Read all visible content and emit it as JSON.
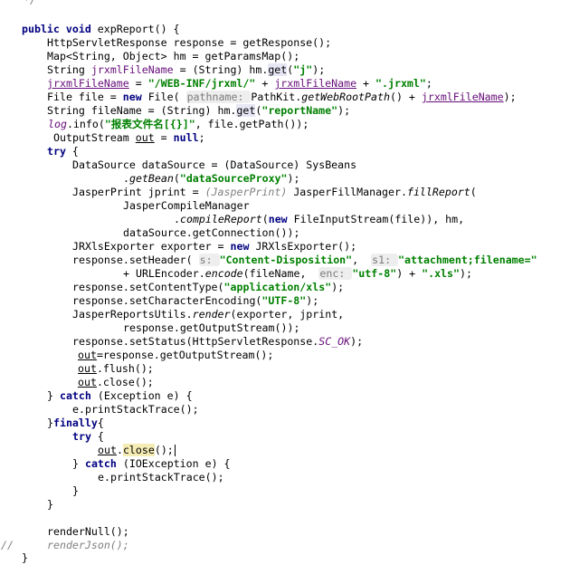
{
  "editor": {
    "code": {
      "l00": {
        "tokens": [
          {
            "c": "cm",
            "t": " */"
          }
        ]
      },
      "l01": {
        "tokens": [
          {
            "c": "kw",
            "t": "public "
          },
          {
            "c": "kw",
            "t": "void "
          },
          {
            "c": "",
            "t": "expReport() {"
          }
        ]
      },
      "l02": {
        "tokens": [
          {
            "c": "",
            "t": "HttpServletResponse response = getResponse();"
          }
        ]
      },
      "l03": {
        "tokens": [
          {
            "c": "",
            "t": "Map<String, Object> hm = getParamsMap();"
          }
        ]
      },
      "l04": {
        "tokens": [
          {
            "c": "",
            "t": "String "
          },
          {
            "c": "fld",
            "t": "jrxmlFileName"
          },
          {
            "c": "",
            "t": " = (String) hm."
          },
          {
            "c": "hl",
            "t": "get"
          },
          {
            "c": "",
            "t": "("
          },
          {
            "c": "str",
            "t": "\"j\""
          },
          {
            "c": "",
            "t": ");"
          }
        ]
      },
      "l05": {
        "tokens": [
          {
            "c": "fld ul",
            "t": "jrxmlFileName"
          },
          {
            "c": "",
            "t": " = "
          },
          {
            "c": "str",
            "t": "\"/WEB-INF/jrxml/\""
          },
          {
            "c": "",
            "t": " + "
          },
          {
            "c": "fld ul",
            "t": "jrxmlFileName"
          },
          {
            "c": "",
            "t": " + "
          },
          {
            "c": "str",
            "t": "\".jrxml\""
          },
          {
            "c": "",
            "t": ";"
          }
        ]
      },
      "l06": {
        "tokens": [
          {
            "c": "",
            "t": "File file = "
          },
          {
            "c": "kw",
            "t": "new "
          },
          {
            "c": "",
            "t": "File( "
          },
          {
            "c": "hint",
            "t": "pathname: "
          },
          {
            "c": "",
            "t": "PathKit."
          },
          {
            "c": "it",
            "t": "getWebRootPath"
          },
          {
            "c": "",
            "t": "() + "
          },
          {
            "c": "fld ul",
            "t": "jrxmlFileName"
          },
          {
            "c": "",
            "t": ");"
          }
        ]
      },
      "l07": {
        "tokens": [
          {
            "c": "",
            "t": "String fileName = (String) hm."
          },
          {
            "c": "hl",
            "t": "get"
          },
          {
            "c": "",
            "t": "("
          },
          {
            "c": "str",
            "t": "\"reportName\""
          },
          {
            "c": "",
            "t": ");"
          }
        ]
      },
      "l08": {
        "tokens": [
          {
            "c": "fldi",
            "t": "log"
          },
          {
            "c": "",
            "t": ".info("
          },
          {
            "c": "str",
            "t": "\"报表文件名[{}]\""
          },
          {
            "c": "",
            "t": ", file.getPath());"
          }
        ]
      },
      "l09": {
        "tokens": [
          {
            "c": "",
            "t": "OutputStream "
          },
          {
            "c": "ul",
            "t": "out"
          },
          {
            "c": "",
            "t": " = "
          },
          {
            "c": "kw",
            "t": "null"
          },
          {
            "c": "",
            "t": ";"
          }
        ]
      },
      "l10": {
        "tokens": [
          {
            "c": "kw",
            "t": "try "
          },
          {
            "c": "",
            "t": "{"
          }
        ]
      },
      "l11": {
        "tokens": [
          {
            "c": "",
            "t": "DataSource dataSource = (DataSource) SysBeans"
          }
        ]
      },
      "l12": {
        "tokens": [
          {
            "c": "",
            "t": "."
          },
          {
            "c": "it",
            "t": "getBean"
          },
          {
            "c": "",
            "t": "("
          },
          {
            "c": "str",
            "t": "\"dataSourceProxy\""
          },
          {
            "c": "",
            "t": ");"
          }
        ]
      },
      "l13": {
        "tokens": [
          {
            "c": "",
            "t": "JasperPrint jprint = "
          },
          {
            "c": "cm",
            "t": "(JasperPrint) "
          },
          {
            "c": "",
            "t": "JasperFillManager."
          },
          {
            "c": "it",
            "t": "fillReport"
          },
          {
            "c": "",
            "t": "("
          }
        ]
      },
      "l14": {
        "tokens": [
          {
            "c": "",
            "t": "JasperCompileManager"
          }
        ]
      },
      "l15": {
        "tokens": [
          {
            "c": "",
            "t": "."
          },
          {
            "c": "it",
            "t": "compileReport"
          },
          {
            "c": "",
            "t": "("
          },
          {
            "c": "kw",
            "t": "new "
          },
          {
            "c": "",
            "t": "FileInputStream(file)), hm,"
          }
        ]
      },
      "l16": {
        "tokens": [
          {
            "c": "",
            "t": "dataSource.getConnection());"
          }
        ]
      },
      "l17": {
        "tokens": [
          {
            "c": "",
            "t": "JRXlsExporter exporter = "
          },
          {
            "c": "kw",
            "t": "new "
          },
          {
            "c": "",
            "t": "JRXlsExporter();"
          }
        ]
      },
      "l18": {
        "tokens": [
          {
            "c": "",
            "t": "response.setHeader( "
          },
          {
            "c": "hint",
            "t": "s: "
          },
          {
            "c": "str",
            "t": "\"Content-Disposition\""
          },
          {
            "c": "",
            "t": ",  "
          },
          {
            "c": "hint",
            "t": "s1: "
          },
          {
            "c": "str",
            "t": "\"attachment;filename=\""
          }
        ]
      },
      "l19": {
        "tokens": [
          {
            "c": "",
            "t": "+ URLEncoder."
          },
          {
            "c": "it",
            "t": "encode"
          },
          {
            "c": "",
            "t": "(fileName,  "
          },
          {
            "c": "hint",
            "t": "enc: "
          },
          {
            "c": "str",
            "t": "\"utf-8\""
          },
          {
            "c": "",
            "t": ") + "
          },
          {
            "c": "str",
            "t": "\".xls\""
          },
          {
            "c": "",
            "t": ");"
          }
        ]
      },
      "l20": {
        "tokens": [
          {
            "c": "",
            "t": "response.setContentType("
          },
          {
            "c": "str",
            "t": "\"application/xls\""
          },
          {
            "c": "",
            "t": ");"
          }
        ]
      },
      "l21": {
        "tokens": [
          {
            "c": "",
            "t": "response.setCharacterEncoding("
          },
          {
            "c": "str",
            "t": "\"UTF-8\""
          },
          {
            "c": "",
            "t": ");"
          }
        ]
      },
      "l22": {
        "tokens": [
          {
            "c": "",
            "t": "JasperReportsUtils."
          },
          {
            "c": "it",
            "t": "render"
          },
          {
            "c": "",
            "t": "(exporter, jprint,"
          }
        ]
      },
      "l23": {
        "tokens": [
          {
            "c": "",
            "t": "response.getOutputStream());"
          }
        ]
      },
      "l24": {
        "tokens": [
          {
            "c": "",
            "t": "response.setStatus(HttpServletResponse."
          },
          {
            "c": "fldi",
            "t": "SC_OK"
          },
          {
            "c": "",
            "t": ");"
          }
        ]
      },
      "l25": {
        "tokens": [
          {
            "c": "ul",
            "t": "out"
          },
          {
            "c": "",
            "t": "=response.getOutputStream();"
          }
        ]
      },
      "l26": {
        "tokens": [
          {
            "c": "ul",
            "t": "out"
          },
          {
            "c": "",
            "t": ".flush();"
          }
        ]
      },
      "l27": {
        "tokens": [
          {
            "c": "ul",
            "t": "out"
          },
          {
            "c": "",
            "t": ".close();"
          }
        ]
      },
      "l28": {
        "tokens": [
          {
            "c": "",
            "t": "} "
          },
          {
            "c": "kw",
            "t": "catch "
          },
          {
            "c": "",
            "t": "(Exception e) {"
          }
        ]
      },
      "l29": {
        "tokens": [
          {
            "c": "",
            "t": "e.printStackTrace();"
          }
        ]
      },
      "l30": {
        "tokens": [
          {
            "c": "",
            "t": "}"
          },
          {
            "c": "kw",
            "t": "finally"
          },
          {
            "c": "",
            "t": "{"
          }
        ]
      },
      "l31": {
        "tokens": [
          {
            "c": "kw",
            "t": "try "
          },
          {
            "c": "",
            "t": "{"
          }
        ]
      },
      "l32": {
        "tokens": [
          {
            "c": "ul",
            "t": "out"
          },
          {
            "c": "",
            "t": "."
          },
          {
            "c": "hly",
            "t": "close"
          },
          {
            "c": "",
            "t": "();"
          }
        ]
      },
      "l33": {
        "tokens": [
          {
            "c": "",
            "t": "} "
          },
          {
            "c": "kw",
            "t": "catch "
          },
          {
            "c": "",
            "t": "(IOException e) {"
          }
        ]
      },
      "l34": {
        "tokens": [
          {
            "c": "",
            "t": "e.printStackTrace();"
          }
        ]
      },
      "l35": {
        "tokens": [
          {
            "c": "",
            "t": "}"
          }
        ]
      },
      "l36": {
        "tokens": [
          {
            "c": "",
            "t": "}"
          }
        ]
      },
      "l37": {
        "tokens": [
          {
            "c": "",
            "t": "renderNull();"
          }
        ]
      },
      "l38": {
        "tokens": [
          {
            "c": "cm",
            "t": "renderJson();"
          }
        ]
      },
      "l39": {
        "tokens": [
          {
            "c": "",
            "t": "}"
          }
        ]
      }
    },
    "gutter_markers": {
      "g38": "//"
    }
  }
}
